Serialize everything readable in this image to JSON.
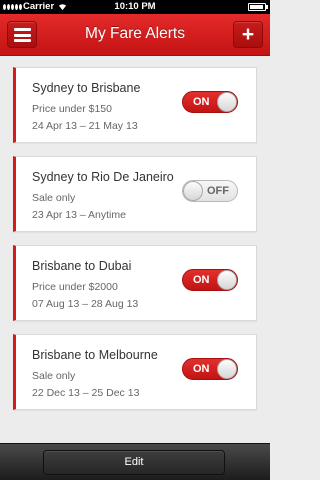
{
  "status_bar": {
    "carrier": "Carrier",
    "time": "10:10 PM"
  },
  "nav": {
    "title": "My Fare Alerts",
    "menu_icon": "hamburger-menu-icon",
    "add_icon": "plus-icon",
    "add_label": "+"
  },
  "alerts": [
    {
      "route": "Sydney to Brisbane",
      "condition": "Price under $150",
      "dates": "24 Apr 13  –  21 May 13",
      "toggle_label": "ON",
      "enabled": true
    },
    {
      "route": "Sydney to Rio De Janeiro",
      "condition": "Sale only",
      "dates": "23 Apr 13  –  Anytime",
      "toggle_label": "OFF",
      "enabled": false
    },
    {
      "route": "Brisbane to Dubai",
      "condition": "Price under $2000",
      "dates": "07 Aug 13  –  28 Aug 13",
      "toggle_label": "ON",
      "enabled": true
    },
    {
      "route": "Brisbane to Melbourne",
      "condition": "Sale only",
      "dates": "22 Dec 13  –  25 Dec 13",
      "toggle_label": "ON",
      "enabled": true
    }
  ],
  "bottom_bar": {
    "edit_label": "Edit"
  },
  "colors": {
    "accent": "#d71a1a",
    "nav_background": "#d01e1e",
    "bottom_bar": "#2a2a2a"
  }
}
